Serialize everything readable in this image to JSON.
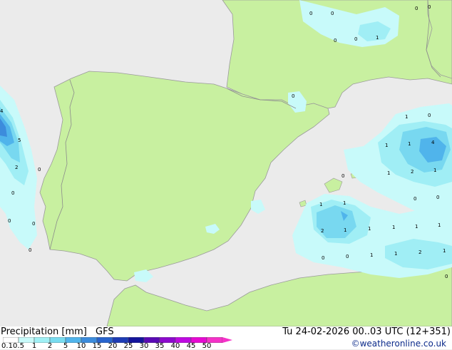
{
  "legend": {
    "title": "Precipitation [mm]",
    "model": "GFS",
    "ticks": [
      "0.1",
      "0.5",
      "1",
      "2",
      "5",
      "10",
      "15",
      "20",
      "25",
      "30",
      "35",
      "40",
      "45",
      "50"
    ],
    "colors": [
      "#ffffff",
      "#c8fafa",
      "#a0f0f5",
      "#78dcf0",
      "#50b4eb",
      "#3c8cdc",
      "#2864cd",
      "#1e3cb4",
      "#14149b",
      "#5a0ab4",
      "#8c0acd",
      "#be0ae1",
      "#e60ad2",
      "#f532c8"
    ]
  },
  "valid_time": "Tu 24-02-2026 00..03 UTC (12+351)",
  "copyright": "©weatheronline.co.uk",
  "map": {
    "colors": {
      "sea": "#ebebeb",
      "land": "#c8f0a0",
      "border": "#8c8c8c",
      "precip_light": "#c8fafa",
      "precip_mid": "#a0eef5",
      "precip_high": "#78d8f0",
      "precip_heavy": "#50b4eb",
      "precip_max": "#3c8cdc"
    },
    "values": [
      {
        "t": "0"
      },
      {
        "t": "0"
      },
      {
        "t": "0"
      },
      {
        "t": "0"
      },
      {
        "t": "1"
      },
      {
        "t": "0"
      },
      {
        "t": "0"
      },
      {
        "t": "0"
      },
      {
        "t": "4"
      },
      {
        "t": "5"
      },
      {
        "t": "2"
      },
      {
        "t": "0"
      },
      {
        "t": "0"
      },
      {
        "t": "0"
      },
      {
        "t": "0"
      },
      {
        "t": "0"
      },
      {
        "t": "1"
      },
      {
        "t": "0"
      },
      {
        "t": "1"
      },
      {
        "t": "1"
      },
      {
        "t": "4"
      },
      {
        "t": "1"
      },
      {
        "t": "2"
      },
      {
        "t": "1"
      },
      {
        "t": "0"
      },
      {
        "t": "0"
      },
      {
        "t": "0"
      },
      {
        "t": "1"
      },
      {
        "t": "1"
      },
      {
        "t": "2"
      },
      {
        "t": "1"
      },
      {
        "t": "1"
      },
      {
        "t": "1"
      },
      {
        "t": "1"
      },
      {
        "t": "1"
      },
      {
        "t": "0"
      },
      {
        "t": "0"
      },
      {
        "t": "1"
      },
      {
        "t": "1"
      },
      {
        "t": "2"
      },
      {
        "t": "1"
      },
      {
        "t": "0"
      }
    ]
  }
}
